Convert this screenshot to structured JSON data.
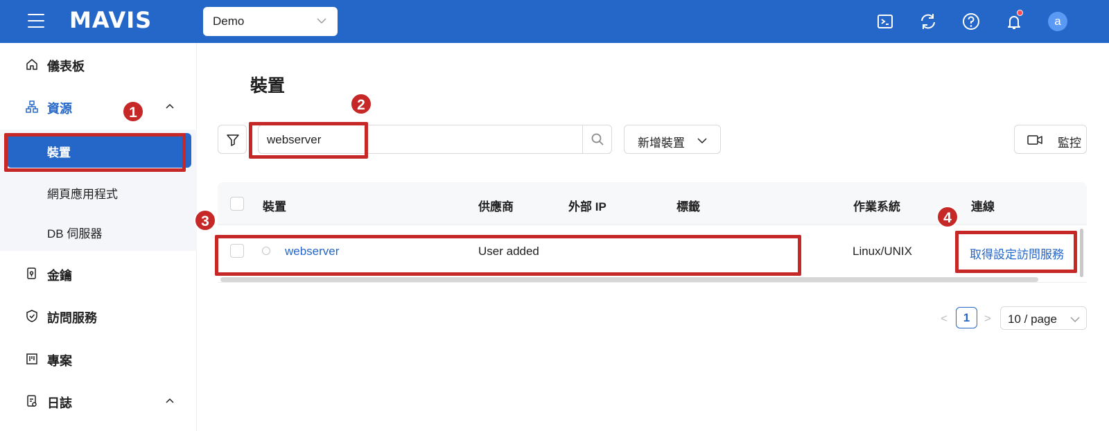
{
  "header": {
    "logo": "MAVIS",
    "env_select": "Demo",
    "avatar_letter": "a",
    "icons": [
      "terminal-icon",
      "refresh-icon",
      "help-icon",
      "bell-icon"
    ]
  },
  "sidebar": {
    "items": [
      {
        "label": "儀表板",
        "icon": "home-icon"
      },
      {
        "label": "資源",
        "icon": "sitemap-icon",
        "open": true
      },
      {
        "label": "金鑰",
        "icon": "key-icon"
      },
      {
        "label": "訪問服務",
        "icon": "shield-check-icon"
      },
      {
        "label": "專案",
        "icon": "project-icon"
      },
      {
        "label": "日誌",
        "icon": "log-icon",
        "open": true
      }
    ],
    "sub_items": [
      {
        "label": "裝置",
        "active": true
      },
      {
        "label": "網頁應用程式"
      },
      {
        "label": "DB 伺服器"
      }
    ]
  },
  "main": {
    "title": "裝置",
    "search": {
      "value": "webserver"
    },
    "add_button": "新增裝置",
    "monitor_button": "監控",
    "table": {
      "columns": [
        "裝置",
        "供應商",
        "外部 IP",
        "標籤",
        "作業系統",
        "連線"
      ],
      "rows": [
        {
          "device": "webserver",
          "vendor": "User added",
          "external_ip": "",
          "tags": "",
          "os": "Linux/UNIX",
          "connection": "取得設定訪問服務"
        }
      ]
    },
    "pagination": {
      "prev": "<",
      "current": "1",
      "next": ">",
      "page_size": "10 / page"
    }
  },
  "annotations": [
    "1",
    "2",
    "3",
    "4"
  ],
  "colors": {
    "primary": "#2567c8",
    "annotation": "#c62828"
  }
}
